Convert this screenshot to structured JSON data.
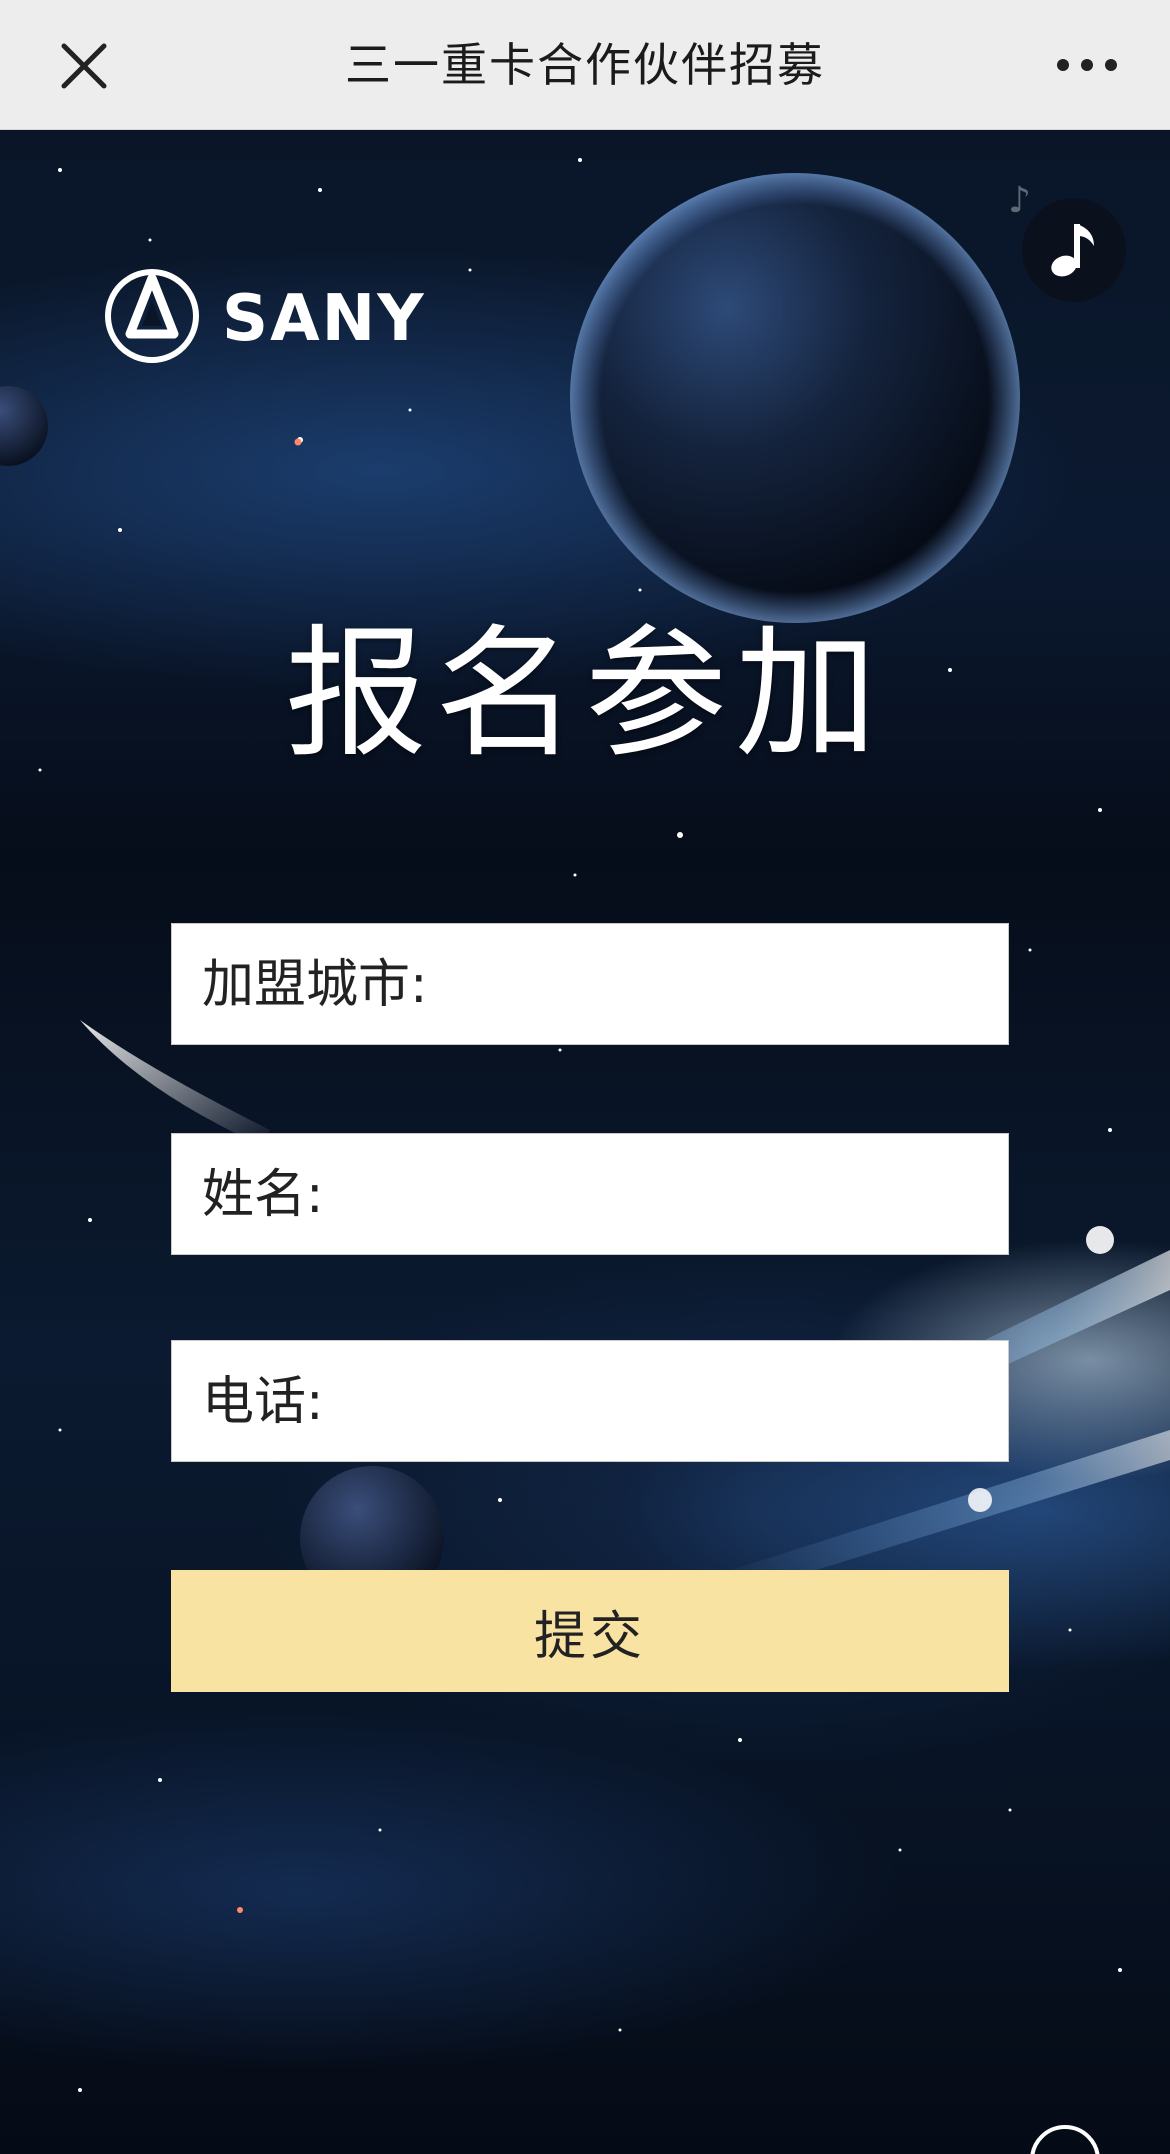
{
  "nav": {
    "title": "三一重卡合作伙伴招募",
    "close_icon": "close-icon",
    "more_icon": "more-icon"
  },
  "brand": {
    "logo_text": "SANY"
  },
  "music": {
    "icon": "music-note-icon"
  },
  "main": {
    "headline": "报名参加"
  },
  "form": {
    "fields": [
      {
        "label": "加盟城市:",
        "value": ""
      },
      {
        "label": "姓名:",
        "value": ""
      },
      {
        "label": "电话:",
        "value": ""
      }
    ],
    "submit_label": "提交"
  },
  "colors": {
    "nav_bg": "#ededed",
    "submit_bg": "#f8e3a3",
    "field_bg": "#ffffff",
    "headline": "#ffffff"
  }
}
